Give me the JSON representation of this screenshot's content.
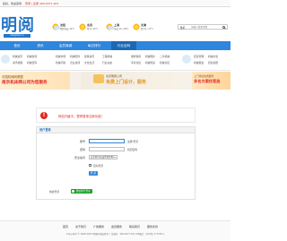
{
  "topbar": {
    "greeting": "您好，欢迎来到",
    "hotline": "登录 | 注册  400-0077-163"
  },
  "logo": {
    "text": "明阅",
    "domain": "xiangmao.cn"
  },
  "weather": [
    {
      "city": "沈阳",
      "desc": "晴转多云 12℃"
    },
    {
      "city": "北京",
      "desc": "晴 8~20℃"
    },
    {
      "city": "上海",
      "desc": "多云 12~18℃"
    },
    {
      "city": "天津",
      "desc": "晴 10~17℃"
    }
  ],
  "search": {
    "type_label": "整机",
    "placeholder": "请输入搜索内容"
  },
  "nav": {
    "items": [
      "首页",
      "资讯",
      "会员商城",
      "每日排行",
      "行业百科"
    ],
    "active_index": 4
  },
  "quick_links": {
    "row1": [
      "机械资讯",
      "机械新闻",
      "机械市场",
      "机械配件",
      "建筑资讯",
      "工程机械",
      "维修保养",
      "机械图片",
      "二手机械",
      "经营管理",
      "机械文化",
      "机械视频"
    ],
    "row2": [
      "资讯视频",
      "机械百科",
      "机械问答",
      "企业新闻",
      "文化生活",
      "行业动态",
      "专家论坛",
      "机械知识",
      "机械论坛",
      "机械展会",
      "招商加盟",
      "机械推荐"
    ]
  },
  "banners": {
    "left_line1": "中国机械网联盟",
    "left_line2": "南京机床网公司为您服务",
    "mid_line1": "北京明阅公司",
    "mid_line2": "免费上门设计，服务",
    "right_line1": "上门评估免费服务",
    "right_line2": "多名方案任您选"
  },
  "notice": {
    "icon": "!",
    "message": "网站升级中，暂停登录注册功能！"
  },
  "login": {
    "title": "用户登录",
    "username_label": "账号",
    "username_hint": "注册/登录",
    "password_label": "密码",
    "password_hint": "找回密码",
    "security_label": "安全提问",
    "security_value": "安全提问(未设置请忽略)",
    "remember_label": "自动登录",
    "submit_label": "登 录",
    "quick_label": "快捷登录",
    "wechat_label": "微信账号登录"
  },
  "footer": {
    "links": [
      "首页",
      "关于我们",
      "广告服务",
      "会员服务",
      "联系我们",
      "服务条款"
    ],
    "copyright": "Copyright © 2008-2023 明阅网 版权所有 广告服务：400-0077-163 ICP备案：京ICP证 177278-1"
  },
  "colors": {
    "brand": "#2576c6",
    "nav": "#2e86de",
    "alert": "#e0281c",
    "wechat": "#19a324"
  }
}
